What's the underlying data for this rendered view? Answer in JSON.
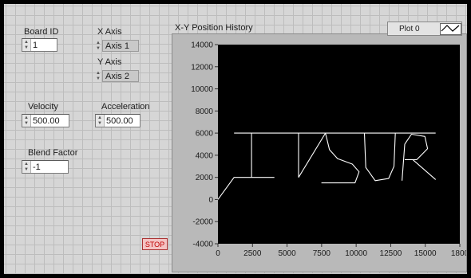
{
  "graph": {
    "title": "X-Y Position History",
    "legend_label": "Plot 0",
    "background_color": "#000000",
    "trace_color": "#ffffff"
  },
  "controls": {
    "board_id": {
      "label": "Board ID",
      "value": "1"
    },
    "x_axis": {
      "label": "X Axis",
      "value": "Axis 1"
    },
    "y_axis": {
      "label": "Y Axis",
      "value": "Axis 2"
    },
    "velocity": {
      "label": "Velocity",
      "value": "500.00"
    },
    "acceleration": {
      "label": "Acceleration",
      "value": "500.00"
    },
    "blend_factor": {
      "label": "Blend Factor",
      "value": "-1"
    },
    "stop_label": "STOP"
  },
  "chart_data": {
    "type": "line",
    "title": "X-Y Position History",
    "xlim": [
      0,
      18000
    ],
    "ylim": [
      -4000,
      14000
    ],
    "xticks": [
      "0",
      "2500",
      "5000",
      "7500",
      "10000",
      "12500",
      "15000",
      "1800"
    ],
    "yticks": [
      "14000",
      "12000",
      "10000",
      "8000",
      "6000",
      "4000",
      "2000",
      "0",
      "-2000",
      "-4000"
    ],
    "grid": false,
    "series": [
      {
        "name": "Plot 0",
        "color": "#ffffff",
        "segments": [
          [
            [
              0,
              0
            ],
            [
              1200,
              2000
            ],
            [
              4200,
              2000
            ]
          ],
          [
            [
              2500,
              2000
            ],
            [
              2500,
              6000
            ]
          ],
          [
            [
              1200,
              6000
            ],
            [
              16200,
              6000
            ]
          ],
          [
            [
              6000,
              2000
            ],
            [
              6000,
              6000
            ]
          ],
          [
            [
              6000,
              2000
            ],
            [
              8000,
              6000
            ]
          ],
          [
            [
              8000,
              6000
            ],
            [
              8300,
              4500
            ],
            [
              8900,
              3700
            ],
            [
              10000,
              3200
            ],
            [
              10500,
              2500
            ],
            [
              10200,
              1500
            ],
            [
              9200,
              1500
            ],
            [
              7700,
              1500
            ]
          ],
          [
            [
              10900,
              6000
            ],
            [
              11000,
              2900
            ],
            [
              11700,
              1700
            ],
            [
              12700,
              1900
            ],
            [
              13100,
              3000
            ],
            [
              13200,
              6000
            ]
          ],
          [
            [
              13700,
              1700
            ],
            [
              13900,
              5000
            ],
            [
              14400,
              5900
            ],
            [
              15400,
              5700
            ],
            [
              15600,
              4600
            ],
            [
              14800,
              3600
            ],
            [
              13900,
              3600
            ]
          ],
          [
            [
              14500,
              3600
            ],
            [
              16200,
              1800
            ]
          ]
        ]
      }
    ]
  }
}
